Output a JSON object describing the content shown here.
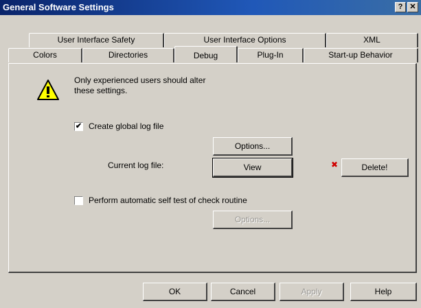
{
  "window": {
    "title": "General Software Settings",
    "help_glyph": "?",
    "close_glyph": "✕"
  },
  "tabs_back": [
    "User Interface Safety",
    "User Interface Options",
    "XML"
  ],
  "tabs_front": [
    "Colors",
    "Directories",
    "Debug",
    "Plug-In",
    "Start-up Behavior"
  ],
  "active_tab": "Debug",
  "warning": {
    "line1": "Only experienced users should alter",
    "line2": "these settings."
  },
  "global_log": {
    "label": "Create global log file",
    "checked": true,
    "check_glyph": "✔"
  },
  "log_options_button": "Options...",
  "current_log": {
    "label": "Current log file:",
    "view_button": "View",
    "delete_button": "Delete!",
    "delete_glyph": "✖"
  },
  "self_test": {
    "label": "Perform automatic self test of check routine",
    "checked": false,
    "options_button": "Options..."
  },
  "footer": {
    "ok": "OK",
    "cancel": "Cancel",
    "apply": "Apply",
    "help": "Help"
  },
  "colors": {
    "title_bar_start": "#0a246a",
    "title_bar_end": "#3a6ea5",
    "warning_yellow": "#ffff00",
    "delete_red": "#d00000"
  }
}
